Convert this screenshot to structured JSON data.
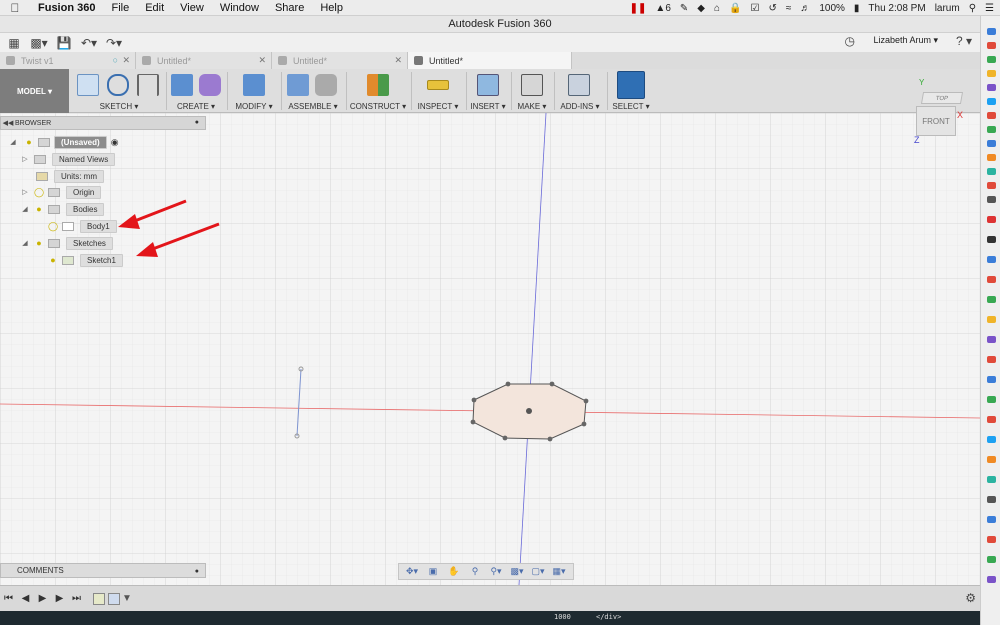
{
  "menubar": {
    "app_name": "Fusion 360",
    "items": [
      "File",
      "Edit",
      "View",
      "Window",
      "Share",
      "Help"
    ],
    "status": {
      "adobe": "6",
      "battery": "100%",
      "clock": "Thu 2:08 PM",
      "user": "larum"
    }
  },
  "window": {
    "title": "Autodesk Fusion 360"
  },
  "qat": {
    "user_name": "Lizabeth Arum ▾",
    "help": "? ▾"
  },
  "tabs": [
    {
      "label": "Twist v1"
    },
    {
      "label": "Untitled*"
    },
    {
      "label": "Untitled*"
    },
    {
      "label": "Untitled*"
    }
  ],
  "ribbon": {
    "mode": "MODEL ▾",
    "groups": [
      "SKETCH ▾",
      "CREATE ▾",
      "MODIFY ▾",
      "ASSEMBLE ▾",
      "CONSTRUCT ▾",
      "INSPECT ▾",
      "INSERT ▾",
      "MAKE ▾",
      "ADD-INS ▾",
      "SELECT ▾"
    ]
  },
  "viewcube": {
    "top": "TOP",
    "front": "FRONT",
    "x": "X",
    "y": "Y",
    "z": "Z"
  },
  "browser": {
    "title": "BROWSER",
    "root": "(Unsaved)",
    "items": [
      "Named Views",
      "Units: mm",
      "Origin",
      "Bodies",
      "Body1",
      "Sketches",
      "Sketch1"
    ]
  },
  "comments": {
    "title": "COMMENTS"
  },
  "bottom": {
    "code_line_no": "1000",
    "code_text": "</div>"
  },
  "colors": {
    "arrow": "#e3151a",
    "x_axis": "#e86a6a",
    "z_axis": "#6a6ad8",
    "sketch": "#555555",
    "profile_fill": "#f3e5dc"
  }
}
